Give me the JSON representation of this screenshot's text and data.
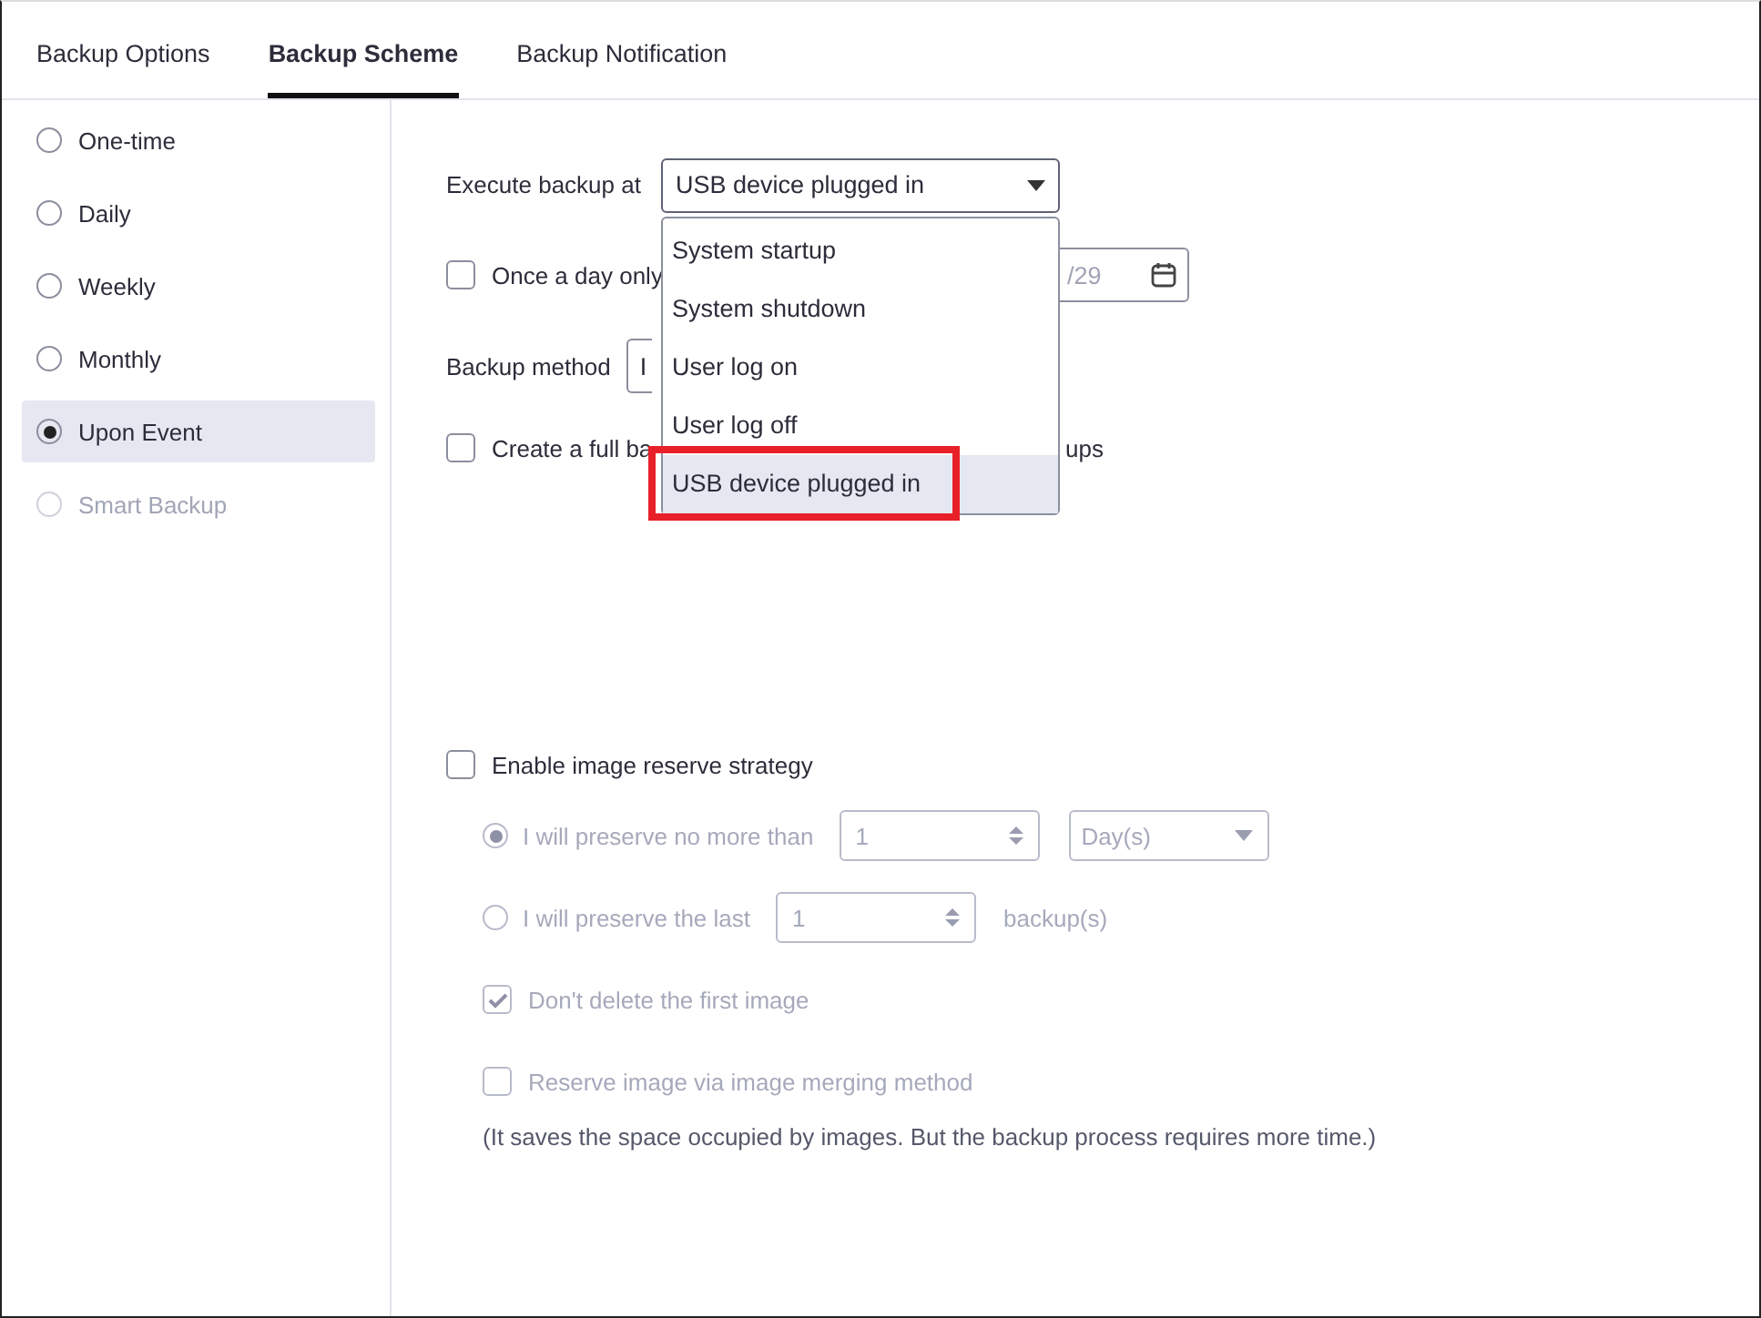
{
  "tabs": [
    {
      "label": "Backup Options",
      "selected": false
    },
    {
      "label": "Backup Scheme",
      "selected": true
    },
    {
      "label": "Backup Notification",
      "selected": false
    }
  ],
  "sidebar": {
    "items": [
      {
        "label": "One-time",
        "selected": false,
        "disabled": false
      },
      {
        "label": "Daily",
        "selected": false,
        "disabled": false
      },
      {
        "label": "Weekly",
        "selected": false,
        "disabled": false
      },
      {
        "label": "Monthly",
        "selected": false,
        "disabled": false
      },
      {
        "label": "Upon Event",
        "selected": true,
        "disabled": false
      },
      {
        "label": "Smart Backup",
        "selected": false,
        "disabled": true
      }
    ]
  },
  "execute": {
    "label": "Execute backup at",
    "value": "USB device plugged in",
    "expanded": true,
    "options": [
      {
        "label": "System startup",
        "selected": false
      },
      {
        "label": "System shutdown",
        "selected": false
      },
      {
        "label": "User log on",
        "selected": false
      },
      {
        "label": "User log off",
        "selected": false
      },
      {
        "label": "USB device plugged in",
        "selected": true
      }
    ]
  },
  "once_a_day": {
    "label": "Once a day only",
    "checked": false,
    "date_value": "/29"
  },
  "backup_method": {
    "label": "Backup method",
    "value": "I"
  },
  "full_backup": {
    "label": "Create a full ba",
    "label_end": "ups",
    "checked": false
  },
  "reserve": {
    "label": "Enable image reserve strategy",
    "checked": false,
    "no_more_than": {
      "label": "I will preserve no more than",
      "selected": true,
      "value": "1",
      "unit": "Day(s)"
    },
    "last": {
      "label": "I will preserve the last",
      "selected": false,
      "value": "1",
      "suffix": "backup(s)"
    },
    "keep_first": {
      "label": "Don't delete the first image",
      "checked": true
    },
    "merge": {
      "label": "Reserve image via image merging method",
      "checked": false
    },
    "note": "(It saves the space occupied by images. But the backup process requires more time.)"
  }
}
